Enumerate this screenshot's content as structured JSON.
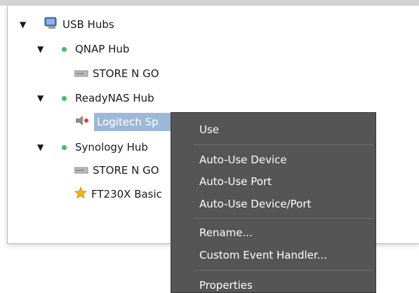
{
  "tree": {
    "root": {
      "label": "USB Hubs",
      "arrow": "▼"
    },
    "hubs": [
      {
        "label": "QNAP Hub",
        "arrow": "▼",
        "devices": [
          {
            "label": "STORE N GO"
          }
        ]
      },
      {
        "label": "ReadyNAS Hub",
        "arrow": "▼",
        "devices": [
          {
            "label": "Logitech Sp"
          }
        ]
      },
      {
        "label": "Synology Hub",
        "arrow": "▼",
        "devices": [
          {
            "label": "STORE N GO"
          },
          {
            "label": "FT230X Basic"
          }
        ]
      }
    ]
  },
  "context_menu": {
    "items": [
      {
        "label": "Use"
      },
      {
        "label": "Auto-Use Device"
      },
      {
        "label": "Auto-Use Port"
      },
      {
        "label": "Auto-Use Device/Port"
      },
      {
        "label": "Rename..."
      },
      {
        "label": "Custom Event Handler..."
      },
      {
        "label": "Properties"
      }
    ]
  },
  "colors": {
    "selection": "#9bb8d8",
    "menu_bg": "#555555",
    "status_dot": "#3fbf5f"
  }
}
